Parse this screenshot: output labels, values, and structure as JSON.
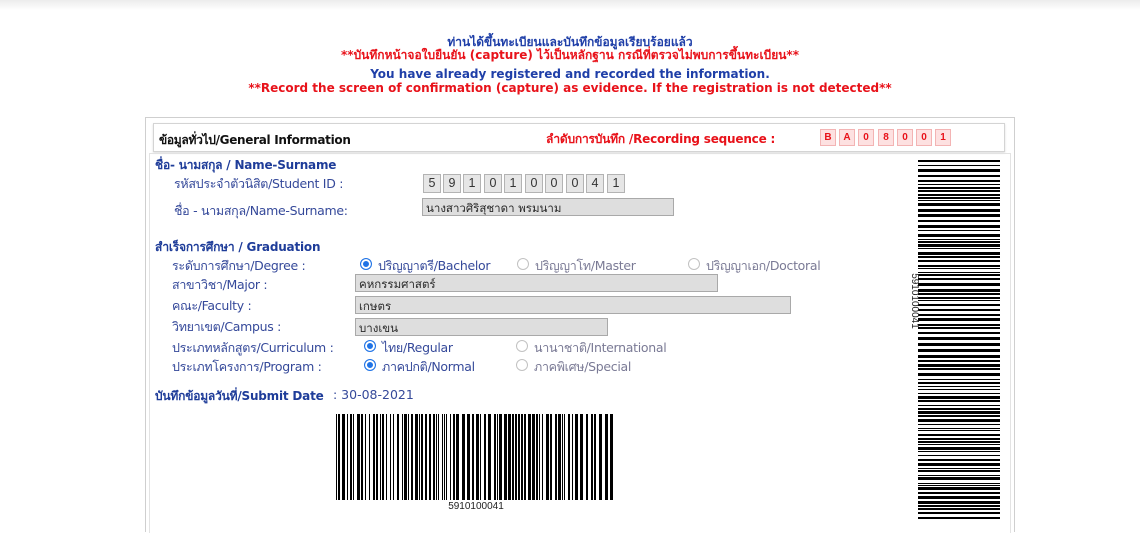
{
  "header": {
    "line1_th": "ท่านได้ขึ้นทะเบียนและบันทึกข้อมูลเรียบร้อยแล้ว",
    "line2_th": "**บันทึกหน้าจอใบยืนยัน (capture) ไว้เป็นหลักฐาน กรณีที่ตรวจไม่พบการขึ้นทะเบียน**",
    "line3_en": "You have already registered and recorded the information.",
    "line4_en": "**Record the screen of confirmation (capture) as evidence. If the registration is not detected**"
  },
  "panel": {
    "title": "ข้อมูลทั่วไป/General Information",
    "sequence_label": "ลำดับการบันทึก /Recording sequence :",
    "sequence": [
      "B",
      "A",
      "0",
      "8",
      "0",
      "0",
      "1"
    ]
  },
  "name_section": {
    "heading": "ชื่อ- นามสกุล / Name-Surname",
    "student_id_label": "รหัสประจำตัวนิสิต/Student ID :",
    "student_id_digits": [
      "5",
      "9",
      "1",
      "0",
      "1",
      "0",
      "0",
      "0",
      "4",
      "1"
    ],
    "name_label": "ชื่อ - นามสกุล/Name-Surname:",
    "name_value": "นางสาวศิริสุชาดา พรมนาม"
  },
  "graduation": {
    "heading": "สำเร็จการศึกษา / Graduation",
    "degree_label": "ระดับการศึกษา/Degree :",
    "degree_options": [
      "ปริญญาตรี/Bachelor",
      "ปริญญาโท/Master",
      "ปริญญาเอก/Doctoral"
    ],
    "degree_selected": 0,
    "major_label": "สาขาวิชา/Major :",
    "major_value": "คหกรรมศาสตร์",
    "faculty_label": "คณะ/Faculty :",
    "faculty_value": "เกษตร",
    "campus_label": "วิทยาเขต/Campus :",
    "campus_value": "บางเขน",
    "curriculum_label": "ประเภทหลักสูตร/Curriculum :",
    "curriculum_options": [
      "ไทย/Regular",
      "นานาชาติ/International"
    ],
    "curriculum_selected": 0,
    "program_label": "ประเภทโครงการ/Program :",
    "program_options": [
      "ภาคปกติ/Normal",
      "ภาคพิเศษ/Special"
    ],
    "program_selected": 0
  },
  "submit": {
    "label": "บันทึกข้อมูลวันที่/Submit Date",
    "value": ": 30-08-2021"
  },
  "barcode": {
    "value": "5910100041"
  },
  "colors": {
    "accent_red": "#e8121a",
    "heading_blue": "#1e3c99",
    "label_blue": "#35499a",
    "radio_blue": "#1f73e6"
  }
}
